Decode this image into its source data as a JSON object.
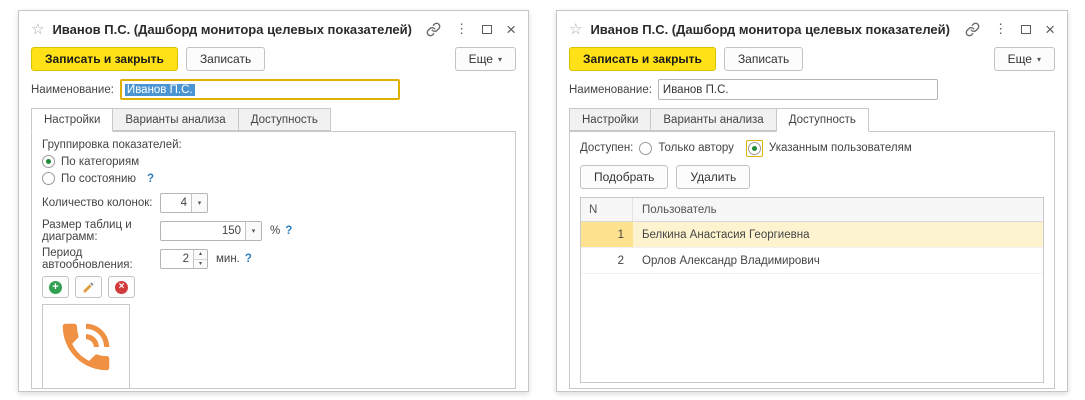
{
  "icons": {
    "star": "☆",
    "dots": "⋮",
    "close": "×",
    "dropdown": "▾",
    "spin_up": "▴",
    "spin_down": "▾",
    "more_arrow": "▾",
    "add_plus": "+",
    "delete_cross": "×",
    "help": "?"
  },
  "colors": {
    "primary_yellow": "#ffe117",
    "selection_blue": "#4b96d2",
    "phone_orange": "#ef9043",
    "add_green": "#31a052",
    "delete_red": "#d23b3b",
    "help_blue": "#2d7fc1",
    "selected_row": "#fdf3cf",
    "selected_row_num": "#ffe28f",
    "focus_border": "#e0b000"
  },
  "left": {
    "title": "Иванов П.С. (Дашборд монитора целевых показателей)",
    "buttons": {
      "save_close": "Записать и закрыть",
      "save": "Записать",
      "more": "Еще"
    },
    "name": {
      "label": "Наименование:",
      "value": "Иванов П.С."
    },
    "tabs": {
      "settings": "Настройки",
      "analysis": "Варианты анализа",
      "access": "Доступность"
    },
    "active_tab": "Настройки",
    "content": {
      "grouping_label": "Группировка показателей:",
      "opt_categories": "По категориям",
      "opt_state": "По состоянию",
      "grouping_selected": "По категориям",
      "columns_label": "Количество колонок:",
      "columns_value": "4",
      "size_label": "Размер таблиц и диаграмм:",
      "size_value": "150",
      "size_unit": "%",
      "period_label": "Период автообновления:",
      "period_value": "2",
      "period_unit": "мин."
    }
  },
  "right": {
    "title": "Иванов П.С. (Дашборд монитора целевых показателей)",
    "buttons": {
      "save_close": "Записать и закрыть",
      "save": "Записать",
      "more": "Еще"
    },
    "name": {
      "label": "Наименование:",
      "value": "Иванов П.С."
    },
    "tabs": {
      "settings": "Настройки",
      "analysis": "Варианты анализа",
      "access": "Доступность"
    },
    "active_tab": "Доступность",
    "content": {
      "access_label": "Доступен:",
      "opt_author": "Только автору",
      "opt_users": "Указанным пользователям",
      "access_selected": "Указанным пользователям",
      "pick_button": "Подобрать",
      "delete_button": "Удалить",
      "table": {
        "col_n": "N",
        "col_user": "Пользователь",
        "rows": [
          {
            "n": "1",
            "user": "Белкина Анастасия Георгиевна"
          },
          {
            "n": "2",
            "user": "Орлов Александр Владимирович"
          }
        ],
        "selected_row_index": 0
      }
    }
  }
}
